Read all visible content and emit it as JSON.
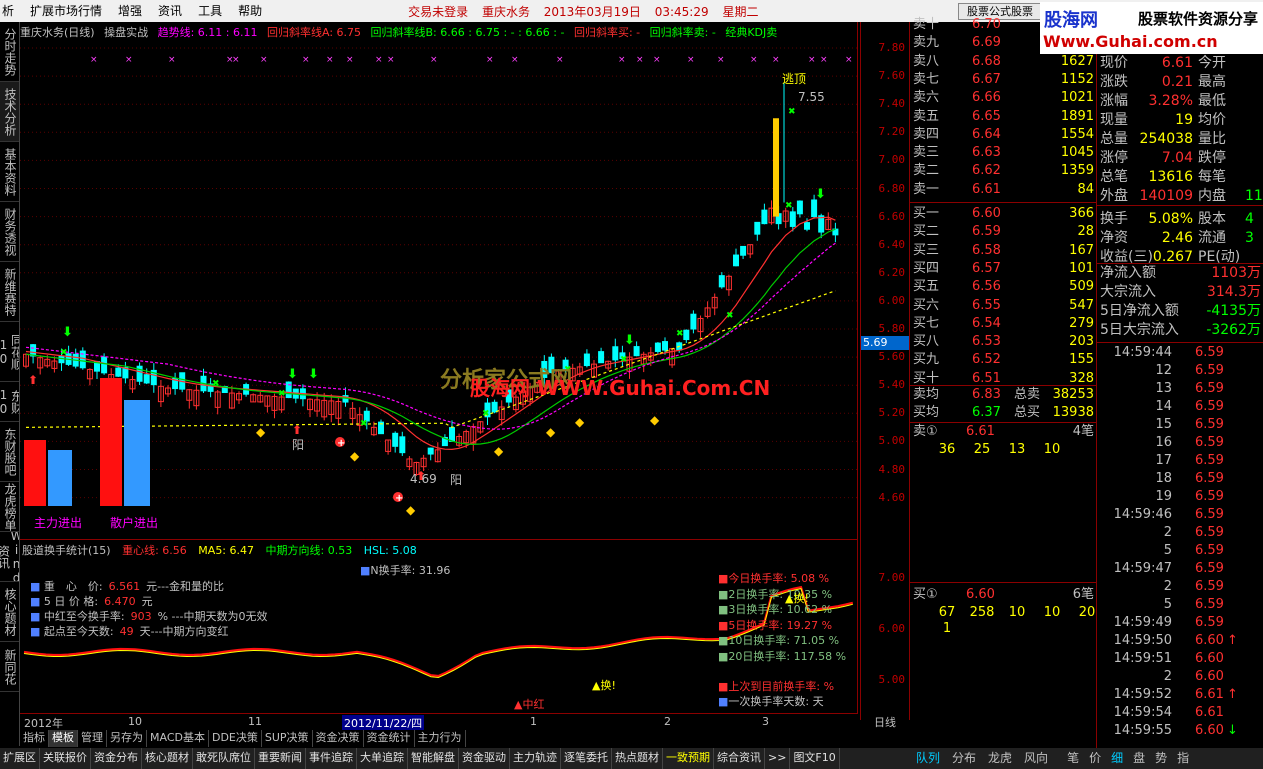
{
  "menu": {
    "items": [
      "扩展市场行情",
      "增强",
      "资讯",
      "工具",
      "帮助"
    ],
    "status": [
      "交易未登录",
      "重庆水务",
      "2013年03月19日",
      "03:45:29",
      "星期二"
    ],
    "formula_btn": "股票公式股票",
    "left_cut": "析"
  },
  "brand": {
    "name": "股海网",
    "slogan": "股票软件资源分享",
    "url": "Www.Guhai.com.cn"
  },
  "left_tabs": [
    "分时走势",
    "技术分析",
    "基本资料",
    "财务透视",
    "新维赛特",
    "同花顺10",
    "东财10",
    "东财股吧",
    "龙虎榜单",
    "Wind资讯",
    "核心题材",
    "新同花"
  ],
  "main_header": {
    "title": "重庆水务(日线)",
    "formula": "操盘实战",
    "trend": "趋势线: 6.11 : 6.11",
    "slope_a": "回归斜率线A: 6.75",
    "slope_b": "回归斜率线B: 6.66 : 6.75 : - : 6.66 : -",
    "buy": "回归斜率买: -",
    "sell": "回归斜率卖: -",
    "kdj": "经典KDJ卖"
  },
  "price_scale": [
    "7.80",
    "7.60",
    "7.40",
    "7.20",
    "7.00",
    "6.80",
    "6.60",
    "6.40",
    "6.20",
    "6.00",
    "5.80",
    "5.60",
    "5.40",
    "5.20",
    "5.00",
    "4.80",
    "4.60"
  ],
  "current_price_mark": "5.69",
  "chart_labels": {
    "escape_top": "逃顶",
    "high": "7.55",
    "low": "4.69",
    "yang1": "阳",
    "yang2": "阳",
    "main_flow": "主力进出",
    "retail_flow": "散户进出",
    "watermark1": "分析家公式网",
    "watermark2": "股海网 WWW.Guhai.Com.CN"
  },
  "sub_header": {
    "title": "股道换手统计(15)",
    "center": "重心线: 6.56",
    "ma5": "MA5: 6.47",
    "mid": "中期方向线: 0.53",
    "hsl": "HSL: 5.08",
    "n_turn": "N换手率: 31.96"
  },
  "sub_info": [
    {
      "label": "重　心　价:",
      "value": "6.561",
      "note": "元---金和量的比"
    },
    {
      "label": "5 日 价 格:",
      "value": "6.470",
      "note": "元"
    },
    {
      "label": "中红至今换手率:",
      "value": "903",
      "note": "% ---中期天数为0无效"
    },
    {
      "label": "起点至今天数:",
      "value": "49",
      "note": "天---中期方向变红"
    }
  ],
  "sub_right": [
    {
      "label": "今日换手率: 5.08 %",
      "color": "#ff3030"
    },
    {
      "label": "2日换手率: 10.35 %",
      "color": "#80c080"
    },
    {
      "label": "3日换手率: 10.62 %",
      "color": "#80c080"
    },
    {
      "label": "5日换手率: 19.27 %",
      "color": "#ff3030"
    },
    {
      "label": "10日换手率: 71.05 %",
      "color": "#80c080"
    },
    {
      "label": "20日换手率: 117.58 %",
      "color": "#80c080"
    }
  ],
  "sub_bottom": [
    "上次到目前换手率: %",
    "一次换手率天数: 天"
  ],
  "sub_markers": {
    "zhonghong": "▲中红",
    "huan": "▲换!",
    "huan2": "▲换!"
  },
  "sub_scale": [
    "7.00",
    "6.00",
    "5.00"
  ],
  "x_axis": [
    {
      "label": "2012年",
      "hl": false
    },
    {
      "label": "10",
      "hl": false
    },
    {
      "label": "11",
      "hl": false
    },
    {
      "label": "2012/11/22/四",
      "hl": true
    },
    {
      "label": "1",
      "hl": false
    },
    {
      "label": "2",
      "hl": false
    },
    {
      "label": "3",
      "hl": false
    }
  ],
  "period": "日线",
  "bottom_tabs1": [
    "指标",
    "模板",
    "管理",
    "另存为",
    "MACD基本",
    "DDE决策",
    "SUP决策",
    "资金决策",
    "资金统计",
    "主力行为"
  ],
  "bottom_tabs2": [
    "扩展区",
    "关联报价",
    "资金分布",
    "核心题材",
    "敢死队席位",
    "重要新闻",
    "事件追踪",
    "大单追踪",
    "智能解盘",
    "资金驱动",
    "主力轨迹",
    "逐笔委托",
    "热点题材",
    "一致预期",
    "综合资讯",
    ">>",
    "图文F10"
  ],
  "right_footer": [
    "队列",
    "分布",
    "龙虎",
    "风向",
    "笔",
    "价",
    "细",
    "盘",
    "势",
    "指"
  ],
  "order_book": {
    "asks": [
      {
        "label": "卖十",
        "price": "6.70",
        "vol": ""
      },
      {
        "label": "卖九",
        "price": "6.69",
        "vol": ""
      },
      {
        "label": "卖八",
        "price": "6.68",
        "vol": "1627"
      },
      {
        "label": "卖七",
        "price": "6.67",
        "vol": "1152"
      },
      {
        "label": "卖六",
        "price": "6.66",
        "vol": "1021"
      },
      {
        "label": "卖五",
        "price": "6.65",
        "vol": "1891"
      },
      {
        "label": "卖四",
        "price": "6.64",
        "vol": "1554"
      },
      {
        "label": "卖三",
        "price": "6.63",
        "vol": "1045"
      },
      {
        "label": "卖二",
        "price": "6.62",
        "vol": "1359"
      },
      {
        "label": "卖一",
        "price": "6.61",
        "vol": "84"
      }
    ],
    "bids": [
      {
        "label": "买一",
        "price": "6.60",
        "vol": "366"
      },
      {
        "label": "买二",
        "price": "6.59",
        "vol": "28"
      },
      {
        "label": "买三",
        "price": "6.58",
        "vol": "167"
      },
      {
        "label": "买四",
        "price": "6.57",
        "vol": "101"
      },
      {
        "label": "买五",
        "price": "6.56",
        "vol": "509"
      },
      {
        "label": "买六",
        "price": "6.55",
        "vol": "547"
      },
      {
        "label": "买七",
        "price": "6.54",
        "vol": "279"
      },
      {
        "label": "买八",
        "price": "6.53",
        "vol": "203"
      },
      {
        "label": "买九",
        "price": "6.52",
        "vol": "155"
      },
      {
        "label": "买十",
        "price": "6.51",
        "vol": "328"
      }
    ],
    "avg_sell": {
      "label": "卖均",
      "price": "6.83",
      "label2": "总卖",
      "vol": "38253"
    },
    "avg_buy": {
      "label": "买均",
      "price": "6.37",
      "label2": "总买",
      "vol": "13938"
    },
    "sell1_queue": {
      "label": "卖①",
      "price": "6.61",
      "count": "4笔",
      "items": [
        "36",
        "25",
        "13",
        "10"
      ]
    },
    "buy1_queue": {
      "label": "买①",
      "price": "6.60",
      "count": "6笔",
      "items": [
        "67",
        "258",
        "10",
        "10",
        "20",
        "1"
      ]
    }
  },
  "quote": [
    {
      "l": "现价",
      "v": "6.61",
      "vc": "#ff3030",
      "l2": "今开",
      "v2": ""
    },
    {
      "l": "涨跌",
      "v": "0.21",
      "vc": "#ff3030",
      "l2": "最高",
      "v2": ""
    },
    {
      "l": "涨幅",
      "v": "3.28%",
      "vc": "#ff3030",
      "l2": "最低",
      "v2": ""
    },
    {
      "l": "现量",
      "v": "19",
      "vc": "#ffff00",
      "l2": "均价",
      "v2": ""
    },
    {
      "l": "总量",
      "v": "254038",
      "vc": "#ffff00",
      "l2": "量比",
      "v2": ""
    },
    {
      "l": "涨停",
      "v": "7.04",
      "vc": "#ff3030",
      "l2": "跌停",
      "v2": ""
    },
    {
      "l": "总笔",
      "v": "13616",
      "vc": "#ffff00",
      "l2": "每笔",
      "v2": ""
    },
    {
      "l": "外盘",
      "v": "140109",
      "vc": "#ff3030",
      "l2": "内盘",
      "v2": "11"
    },
    {
      "l": "换手",
      "v": "5.08%",
      "vc": "#ffff00",
      "l2": "股本",
      "v2": "4"
    },
    {
      "l": "净资",
      "v": "2.46",
      "vc": "#ffff00",
      "l2": "流通",
      "v2": "3"
    },
    {
      "l": "收益(三)",
      "v": "0.267",
      "vc": "#ffff00",
      "l2": "PE(动)",
      "v2": ""
    }
  ],
  "flows": [
    {
      "l": "净流入额",
      "v": "1103万",
      "c": "#ff3030"
    },
    {
      "l": "大宗流入",
      "v": "314.3万",
      "c": "#ff3030"
    },
    {
      "l": "5日净流入额",
      "v": "-4135万",
      "c": "#00ff00"
    },
    {
      "l": "5日大宗流入",
      "v": "-3262万",
      "c": "#00ff00"
    }
  ],
  "ticks": [
    {
      "t": "14:59:44",
      "p": "6.59",
      "a": ""
    },
    {
      "t": "12",
      "p": "6.59",
      "a": ""
    },
    {
      "t": "13",
      "p": "6.59",
      "a": ""
    },
    {
      "t": "14",
      "p": "6.59",
      "a": ""
    },
    {
      "t": "15",
      "p": "6.59",
      "a": ""
    },
    {
      "t": "16",
      "p": "6.59",
      "a": ""
    },
    {
      "t": "17",
      "p": "6.59",
      "a": ""
    },
    {
      "t": "18",
      "p": "6.59",
      "a": ""
    },
    {
      "t": "19",
      "p": "6.59",
      "a": ""
    },
    {
      "t": "14:59:46",
      "p": "6.59",
      "a": ""
    },
    {
      "t": "2",
      "p": "6.59",
      "a": ""
    },
    {
      "t": "5",
      "p": "6.59",
      "a": ""
    },
    {
      "t": "14:59:47",
      "p": "6.59",
      "a": ""
    },
    {
      "t": "2",
      "p": "6.59",
      "a": ""
    },
    {
      "t": "5",
      "p": "6.59",
      "a": ""
    },
    {
      "t": "14:59:49",
      "p": "6.59",
      "a": ""
    },
    {
      "t": "14:59:50",
      "p": "6.60",
      "a": "↑"
    },
    {
      "t": "14:59:51",
      "p": "6.60",
      "a": ""
    },
    {
      "t": "2",
      "p": "6.60",
      "a": ""
    },
    {
      "t": "14:59:52",
      "p": "6.61",
      "a": "↑"
    },
    {
      "t": "14:59:54",
      "p": "6.61",
      "a": ""
    },
    {
      "t": "14:59:55",
      "p": "6.60",
      "a": "↓"
    }
  ]
}
